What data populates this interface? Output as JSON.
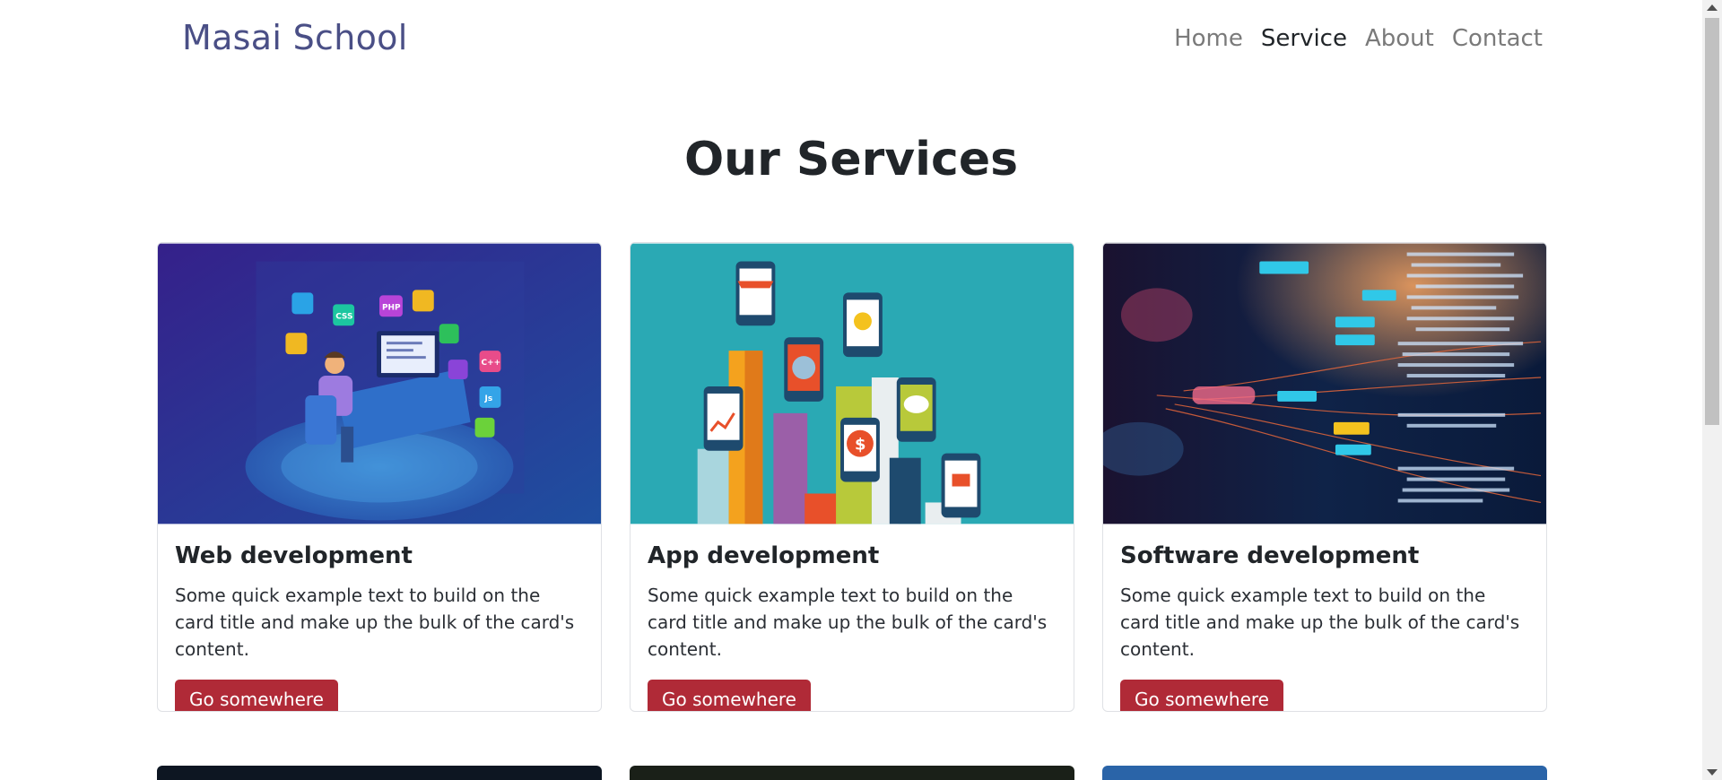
{
  "brand": "Masai School",
  "nav": [
    {
      "label": "Home",
      "active": false
    },
    {
      "label": "Service",
      "active": true
    },
    {
      "label": "About",
      "active": false
    },
    {
      "label": "Contact",
      "active": false
    }
  ],
  "section_title": "Our Services",
  "cards": [
    {
      "title": "Web development",
      "text": "Some quick example text to build on the card title and make up the bulk of the card's content.",
      "button": "Go somewhere",
      "image": "web-development-illustration"
    },
    {
      "title": "App development",
      "text": "Some quick example text to build on the card title and make up the bulk of the card's content.",
      "button": "Go somewhere",
      "image": "app-development-illustration"
    },
    {
      "title": "Software development",
      "text": "Some quick example text to build on the card title and make up the bulk of the card's content.",
      "button": "Go somewhere",
      "image": "software-development-photo"
    }
  ],
  "colors": {
    "brand": "#4a4f86",
    "button": "#b02a37",
    "card_border": "#dfe1e5"
  }
}
